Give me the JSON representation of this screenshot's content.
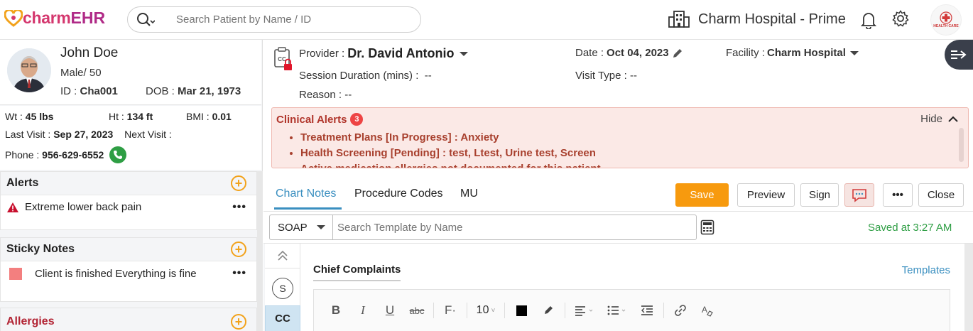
{
  "app": {
    "logo_charm": "charm",
    "logo_ehr": "EHR",
    "search_placeholder": "Search Patient by Name / ID",
    "hospital_name": "Charm Hospital - Prime",
    "org_logo_text": "HEALTH CARE"
  },
  "patient": {
    "name": "John Doe",
    "sex_age": "Male/ 50",
    "id_label": "ID : ",
    "id_value": "Cha001",
    "dob_label": "DOB : ",
    "dob_value": "Mar 21, 1973",
    "wt_label": "Wt : ",
    "wt_value": "45 lbs",
    "ht_label": "Ht : ",
    "ht_value": "134 ft",
    "bmi_label": "BMI : ",
    "bmi_value": "0.01",
    "last_visit_label": "Last Visit : ",
    "last_visit_value": "Sep 27, 2023",
    "next_visit_label": "Next Visit :",
    "phone_label": "Phone : ",
    "phone_value": "956-629-6552"
  },
  "sidebar": {
    "alerts_title": "Alerts",
    "alert_item": "Extreme lower back pain",
    "sticky_title": "Sticky Notes",
    "sticky_item": "Client is finished Everything is fine",
    "allergies_title": "Allergies",
    "more": "•••"
  },
  "encounter": {
    "provider_label": "Provider : ",
    "provider_value": "Dr. David Antonio",
    "session_label": "Session Duration (mins) :",
    "session_value": "--",
    "reason_label": "Reason : ",
    "reason_value": "--",
    "date_label": "Date : ",
    "date_value": "Oct 04, 2023",
    "visit_type_label": "Visit Type : ",
    "visit_type_value": "--",
    "facility_label": "Facility : ",
    "facility_value": "Charm Hospital"
  },
  "clinical_alerts": {
    "title": "Clinical Alerts",
    "count": "3",
    "hide_label": "Hide",
    "items": [
      "Treatment Plans [In Progress] : Anxiety",
      "Health Screening [Pending] : test, Ltest, Urine test, Screen",
      "Active medication allergies not documented for this patient"
    ]
  },
  "tabs": [
    "Chart Notes",
    "Procedure Codes",
    "MU"
  ],
  "actions": {
    "save": "Save",
    "preview": "Preview",
    "sign": "Sign",
    "more": "•••",
    "close": "Close"
  },
  "template_bar": {
    "type": "SOAP",
    "search_placeholder": "Search Template by Name",
    "saved_status": "Saved at 3:27 AM"
  },
  "editor": {
    "side_s": "S",
    "side_cc": "CC",
    "section_title": "Chief Complaints",
    "templates_link": "Templates",
    "font_size": "10"
  },
  "colors": {
    "brand": "#d4376e",
    "accent": "#3a8fc0",
    "save": "#f79a0e",
    "alert_bg": "#fbe9e6",
    "alert_text": "#a8402e",
    "saved_green": "#2e9e44"
  }
}
